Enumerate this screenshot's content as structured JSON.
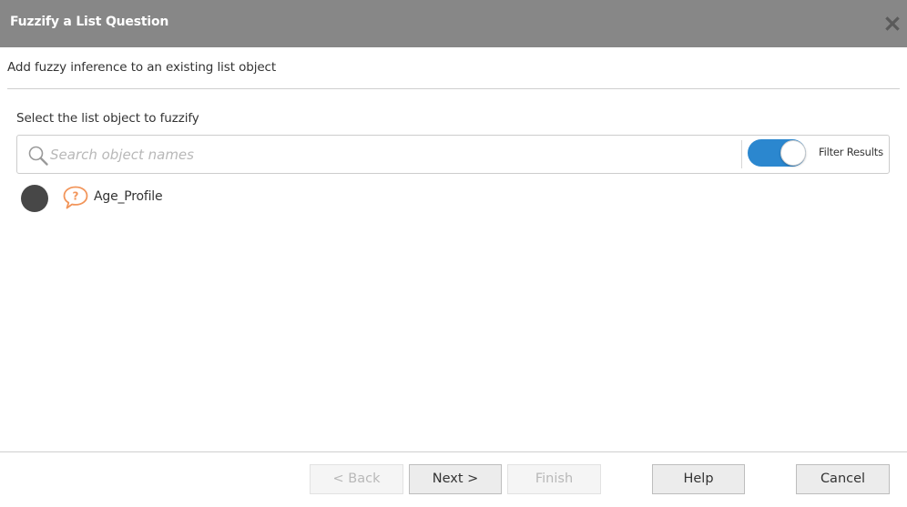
{
  "window": {
    "title": "Fuzzify a List Question",
    "close_icon": "close-icon"
  },
  "header": {
    "subtitle": "Add fuzzy inference to an existing list object"
  },
  "selector": {
    "label": "Select the list object to fuzzify",
    "search": {
      "placeholder": "Search object names",
      "value": "",
      "icon": "search-icon"
    },
    "filter": {
      "label": "Filter Results",
      "enabled": true,
      "on_color": "#2b87cf"
    }
  },
  "items": [
    {
      "name": "Age_Profile",
      "status_icon": "status-dot-icon",
      "type_icon": "question-bubble-icon",
      "status_color": "#474747",
      "type_color": "#f2955a"
    }
  ],
  "footer": {
    "back_label": "< Back",
    "next_label": "Next >",
    "finish_label": "Finish",
    "help_label": "Help",
    "cancel_label": "Cancel"
  },
  "colors": {
    "titlebar": "#878787",
    "accent": "#2b87cf"
  }
}
